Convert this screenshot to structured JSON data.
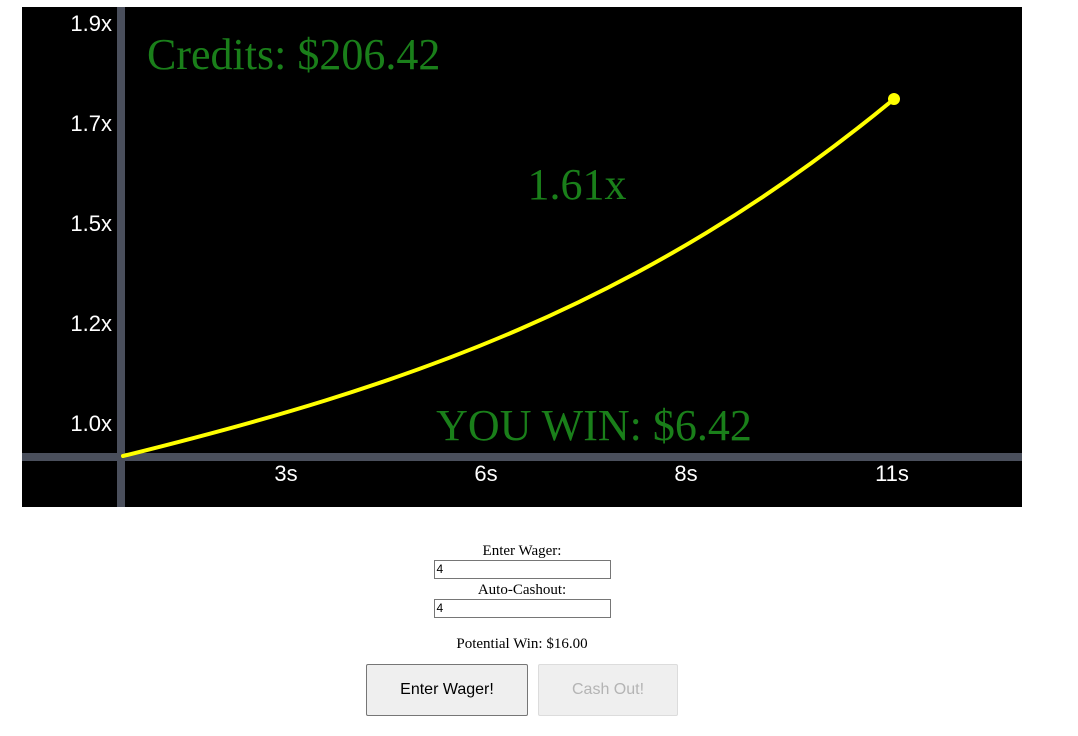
{
  "game": {
    "credits_text": "Credits: $206.42",
    "multiplier_text": "1.61x",
    "result_text": "YOU WIN: $6.42",
    "y_ticks": [
      "1.9x",
      "1.7x",
      "1.5x",
      "1.2x",
      "1.0x"
    ],
    "x_ticks": [
      "3s",
      "6s",
      "8s",
      "11s"
    ],
    "colors": {
      "background": "#000000",
      "axis": "#4a4f5c",
      "curve": "#ffff00",
      "overlay_text": "#1a7f1a",
      "tick_text": "#ffffff"
    }
  },
  "controls": {
    "wager_label": "Enter Wager:",
    "wager_value": "4",
    "autocashout_label": "Auto-Cashout:",
    "autocashout_value": "4",
    "potential_win_text": "Potential Win: $16.00",
    "enter_wager_button": "Enter Wager!",
    "cash_out_button": "Cash Out!"
  }
}
